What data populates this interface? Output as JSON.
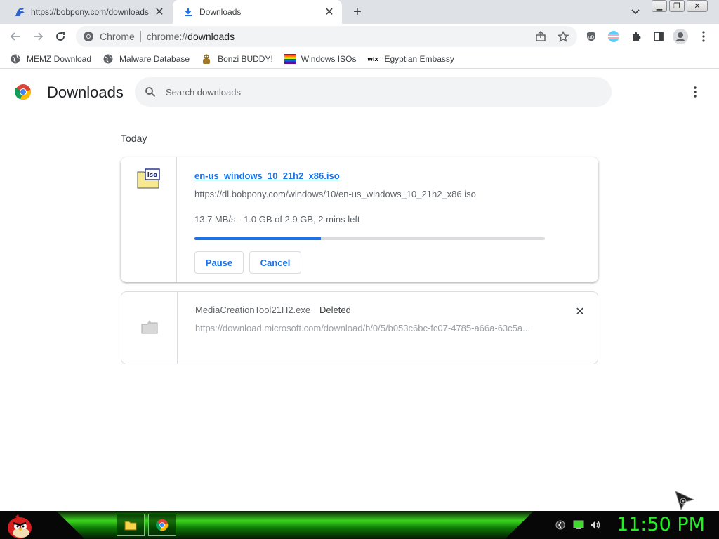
{
  "tabs": [
    {
      "title": "https://bobpony.com/downloads",
      "icon": "sonic-favicon-icon",
      "active": false
    },
    {
      "title": "Downloads",
      "icon": "download-icon",
      "active": true
    }
  ],
  "omnibox": {
    "site": "Chrome",
    "scheme": "chrome://",
    "path": "downloads"
  },
  "bookmarks": [
    {
      "label": "MEMZ Download",
      "icon": "globe-icon"
    },
    {
      "label": "Malware Database",
      "icon": "globe-icon"
    },
    {
      "label": "Bonzi BUDDY!",
      "icon": "bonzi-icon"
    },
    {
      "label": "Windows ISOs",
      "icon": "rainbow-flag-icon"
    },
    {
      "label": "Egyptian Embassy",
      "icon": "wix-icon"
    }
  ],
  "downloads_page": {
    "title": "Downloads",
    "search_placeholder": "Search downloads",
    "section": "Today",
    "items": [
      {
        "filename": "en-us_windows_10_21h2_x86.iso",
        "url": "https://dl.bobpony.com/windows/10/en-us_windows_10_21h2_x86.iso",
        "status": "13.7 MB/s - 1.0 GB of 2.9 GB, 2 mins left",
        "progress": 0.36,
        "pause_label": "Pause",
        "cancel_label": "Cancel"
      },
      {
        "filename": "MediaCreationTool21H2.exe",
        "state": "Deleted",
        "url": "https://download.microsoft.com/download/b/0/5/b053c6bc-fc07-4785-a66a-63c5a..."
      }
    ]
  },
  "taskbar": {
    "clock": "11:50 PM"
  },
  "colors": {
    "accent": "#1a73e8",
    "clock": "#1ff21f",
    "taskbar_glow": "#3bd61e"
  }
}
